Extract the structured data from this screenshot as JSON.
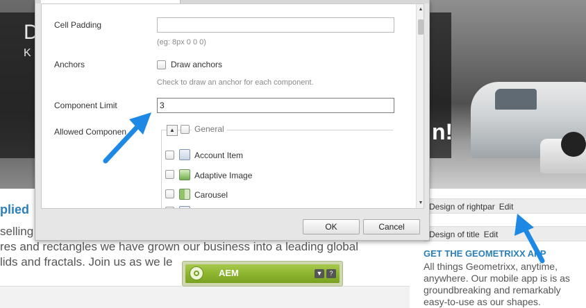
{
  "dialog": {
    "fields": {
      "cell_padding_label": "Cell Padding",
      "cell_padding_value": "",
      "cell_padding_hint": "(eg: 8px 0 0 0)",
      "anchors_label": "Anchors",
      "draw_anchors_label": "Draw anchors",
      "anchors_hint": "Check to draw an anchor for each component.",
      "component_limit_label": "Component Limit",
      "component_limit_value": "3",
      "allowed_components_label": "Allowed Componen"
    },
    "allowed_components": {
      "group_label": "General",
      "items": [
        {
          "label": "Account Item",
          "icon": "account-item-icon"
        },
        {
          "label": "Adaptive Image",
          "icon": "image-icon"
        },
        {
          "label": "Carousel",
          "icon": "carousel-icon"
        }
      ]
    },
    "buttons": {
      "ok": "OK",
      "cancel": "Cancel"
    }
  },
  "page": {
    "hero_left_big": "D",
    "hero_left_small": "K",
    "hero_right_text": "n!",
    "heading_fragment": "plied",
    "body_lines": [
      "selling",
      "res and rectangles we have grown our business into a leading global",
      "lids and fractals. Join us as we le"
    ]
  },
  "right_column": {
    "design_rightpar": "Design of rightpar",
    "design_title": "Design of title",
    "edit_label": "Edit",
    "app_title": "GET THE GEOMETRIXX APP",
    "app_lines": [
      "All things Geometrixx, anytime,",
      "anywhere. Our mobile app is is as",
      "groundbreaking and remarkably",
      "easy-to-use as our shapes."
    ]
  },
  "sidekick": {
    "title": "AEM"
  },
  "colors": {
    "accent_blue": "#2a7fb8",
    "arrow_blue": "#1e88e5",
    "aem_green": "#8db52f"
  }
}
